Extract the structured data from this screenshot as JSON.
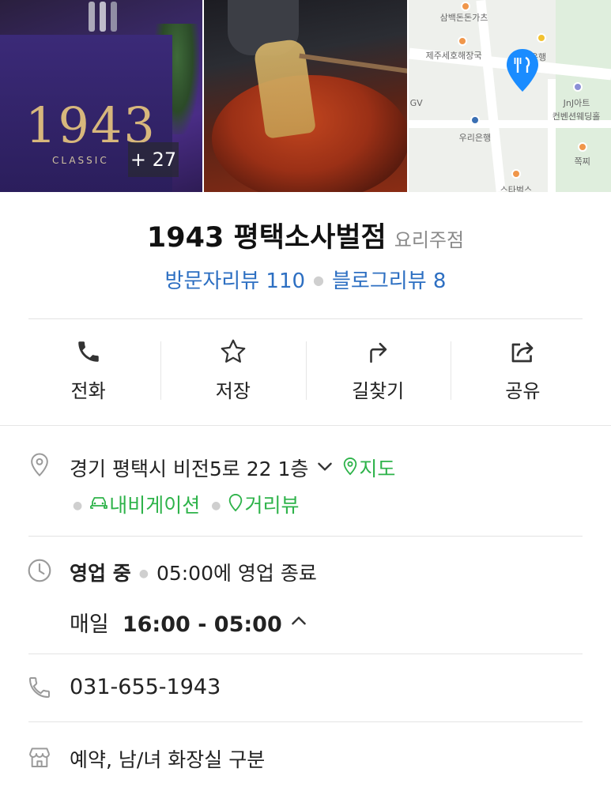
{
  "photos": {
    "more_badge": "+ 27",
    "sign_number": "1943",
    "sign_subtitle": "CLASSIC",
    "map_labels": [
      "삼백돈돈가츠",
      "제주세호해장국",
      "농협은행",
      "GV",
      "JnJ아트",
      "컨벤션웨딩홀",
      "우리은행",
      "쪽찌",
      "스타벅스"
    ]
  },
  "place": {
    "name": "1943 평택소사벌점",
    "category": "요리주점",
    "visitor_reviews": "방문자리뷰 110",
    "blog_reviews": "블로그리뷰 8"
  },
  "actions": [
    {
      "label": "전화",
      "icon": "phone-icon"
    },
    {
      "label": "저장",
      "icon": "star-icon"
    },
    {
      "label": "길찾기",
      "icon": "directions-icon"
    },
    {
      "label": "공유",
      "icon": "share-icon"
    }
  ],
  "address": {
    "text": "경기 평택시 비전5로 22 1층",
    "map_link": "지도",
    "navigation_link": "내비게이션",
    "streetview_link": "거리뷰"
  },
  "hours": {
    "status": "영업 중",
    "close_info": "05:00에 영업 종료",
    "day": "매일",
    "time": "16:00 - 05:00"
  },
  "phone": "031-655-1943",
  "amenities": "예약, 남/녀 화장실 구분",
  "colors": {
    "link_blue": "#2d6fc2",
    "accent_green": "#2eb34a",
    "map_pin_blue": "#1a8cff"
  }
}
